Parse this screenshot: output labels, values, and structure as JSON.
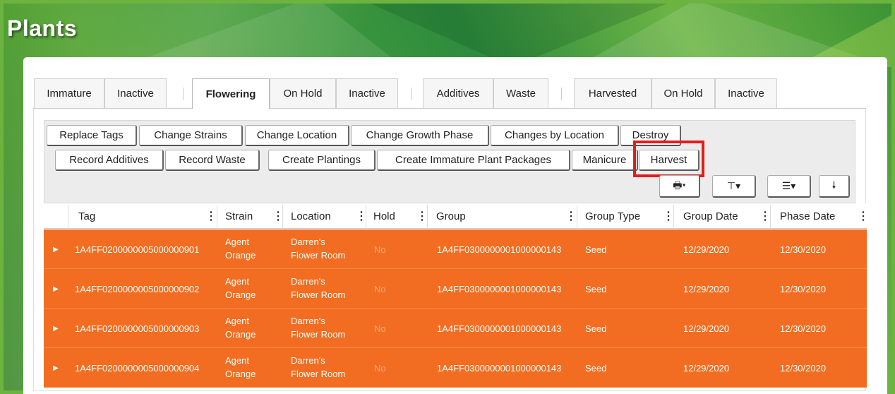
{
  "page": {
    "title": "Plants"
  },
  "tabs": [
    {
      "label": "Immature",
      "active": false
    },
    {
      "label": "Inactive",
      "active": false
    },
    {
      "label": "Flowering",
      "active": true
    },
    {
      "label": "On Hold",
      "active": false
    },
    {
      "label": "Inactive",
      "active": false
    },
    {
      "label": "Additives",
      "active": false
    },
    {
      "label": "Waste",
      "active": false
    },
    {
      "label": "Harvested",
      "active": false
    },
    {
      "label": "On Hold",
      "active": false
    },
    {
      "label": "Inactive",
      "active": false
    }
  ],
  "toolbar": {
    "row1": [
      "Replace Tags",
      "Change Strains",
      "Change Location",
      "Change Growth Phase",
      "Changes by Location",
      "Destroy"
    ],
    "row2": [
      "Record Additives",
      "Record Waste",
      "Create Plantings",
      "Create Immature Plant Packages",
      "Manicure",
      "Harvest"
    ],
    "highlighted": "Harvest",
    "highlight_color": "#e01e1e",
    "icons": [
      {
        "name": "print-icon",
        "glyph": "🖶▾"
      },
      {
        "name": "filter-icon",
        "glyph": "⊤▾"
      },
      {
        "name": "columns-menu-icon",
        "glyph": "☰▾"
      },
      {
        "name": "download-icon",
        "glyph": "🠗"
      }
    ]
  },
  "grid": {
    "columns": [
      "Tag",
      "Strain",
      "Location",
      "Hold",
      "Group",
      "Group Type",
      "Group Date",
      "Phase Date"
    ],
    "row_color": "#f26d21",
    "rows": [
      {
        "tag": "1A4FF0200000005000000901",
        "strain1": "Agent",
        "strain2": "Orange",
        "loc1": "Darren's",
        "loc2": "Flower Room",
        "hold": "No",
        "group": "1A4FF0300000001000000143",
        "group_type": "Seed",
        "group_date": "12/29/2020",
        "phase_date": "12/30/2020"
      },
      {
        "tag": "1A4FF0200000005000000902",
        "strain1": "Agent",
        "strain2": "Orange",
        "loc1": "Darren's",
        "loc2": "Flower Room",
        "hold": "No",
        "group": "1A4FF0300000001000000143",
        "group_type": "Seed",
        "group_date": "12/29/2020",
        "phase_date": "12/30/2020"
      },
      {
        "tag": "1A4FF0200000005000000903",
        "strain1": "Agent",
        "strain2": "Orange",
        "loc1": "Darren's",
        "loc2": "Flower Room",
        "hold": "No",
        "group": "1A4FF0300000001000000143",
        "group_type": "Seed",
        "group_date": "12/29/2020",
        "phase_date": "12/30/2020"
      },
      {
        "tag": "1A4FF0200000005000000904",
        "strain1": "Agent",
        "strain2": "Orange",
        "loc1": "Darren's",
        "loc2": "Flower Room",
        "hold": "No",
        "group": "1A4FF0300000001000000143",
        "group_type": "Seed",
        "group_date": "12/29/2020",
        "phase_date": "12/30/2020"
      }
    ]
  }
}
